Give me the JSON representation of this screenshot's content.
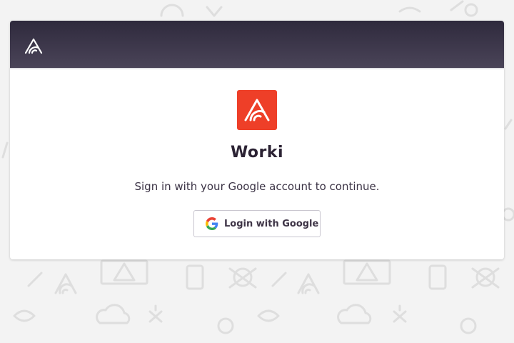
{
  "page": {
    "background_color": "#f3f3f3",
    "header_gradient": [
      "#2f2a3d",
      "#4a4458"
    ],
    "accent": "#ee3f28"
  },
  "header": {
    "logo_icon": "sentry-logo-icon"
  },
  "login": {
    "app_logo_icon": "sentry-logo-icon",
    "app_name": "Worki",
    "subtitle": "Sign in with your Google account to continue.",
    "google_button_icon": "google-g-icon",
    "google_button_label": "Login with Google"
  },
  "background": {
    "pattern_icons": [
      "sentry-logo-icon",
      "warning-icon",
      "skull-icon",
      "cloud-icon",
      "bug-icon",
      "fish-icon",
      "swimmer-icon",
      "apple-icon",
      "chart-icon"
    ]
  }
}
